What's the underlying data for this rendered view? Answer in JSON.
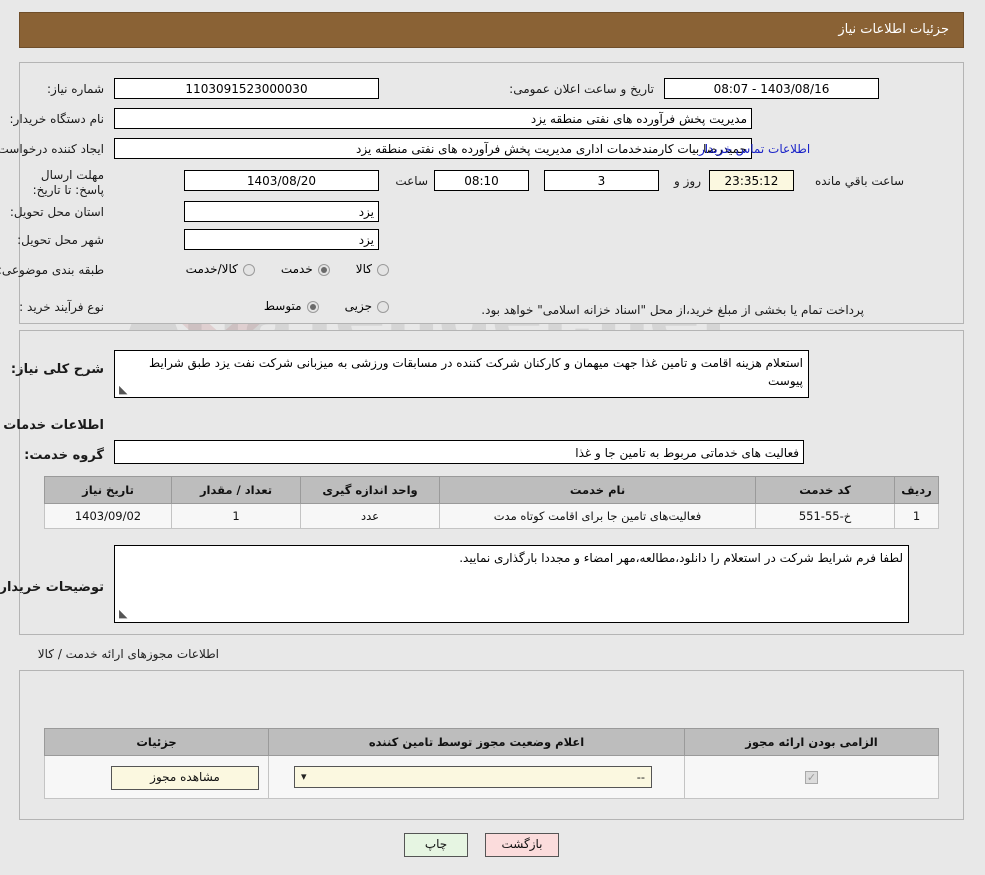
{
  "header": {
    "title": "جزئیات اطلاعات نیاز"
  },
  "watermark": {
    "text": "AriaTender.net"
  },
  "main": {
    "need_number_label": "شماره نیاز:",
    "need_number_value": "1103091523000030",
    "public_announce_label": "تاریخ و ساعت اعلان عمومی:",
    "public_announce_value": "1403/08/16 - 08:07",
    "buyer_org_label": "نام دستگاه خریدار:",
    "buyer_org_value": "مدیریت پخش فرآورده های نفتی منطقه یزد",
    "creator_label": "ایجاد کننده درخواست:",
    "creator_value": "حمیدرضا بیات کارمندخدمات اداری مدیریت پخش فرآورده های نفتی منطقه یزد",
    "contact_link": "اطلاعات تماس خریدار",
    "deadline_label": "مهلت ارسال پاسخ: تا تاریخ:",
    "deadline_date": "1403/08/20",
    "hour_label": "ساعت",
    "deadline_time": "08:10",
    "days_left": "3",
    "days_unit_label": "روز و",
    "time_left": "23:35:12",
    "time_left_suffix": "ساعت باقي مانده",
    "province_label": "استان محل تحویل:",
    "province_value": "یزد",
    "city_label": "شهر محل تحویل:",
    "city_value": "یزد",
    "category_label": "طبقه بندی موضوعی:",
    "category_options": [
      {
        "label": "کالا",
        "selected": false
      },
      {
        "label": "خدمت",
        "selected": true
      },
      {
        "label": "کالا/خدمت",
        "selected": false
      }
    ],
    "process_label": "نوع فرآیند خرید :",
    "process_options": [
      {
        "label": "جزیی",
        "selected": false
      },
      {
        "label": "متوسط",
        "selected": true
      }
    ],
    "process_note": "پرداخت تمام یا بخشی از مبلغ خرید،از محل \"اسناد خزانه اسلامی\" خواهد بود."
  },
  "description": {
    "general_label": "شرح کلی نیاز:",
    "general_value": "استعلام هزینه اقامت و تامین غذا جهت میهمان و کارکنان شرکت کننده در مسابقات ورزشی به میزبانی شرکت نفت یزد طبق شرایط پیوست",
    "services_section_title": "اطلاعات خدمات مورد نیاز",
    "service_group_label": "گروه خدمت:",
    "service_group_value": "فعالیت های خدماتی مربوط به تامین جا و غذا",
    "buyer_notes_label": "توضیحات خریدار:",
    "buyer_notes_value": "لطفا فرم شرایط شرکت در استعلام را دانلود،مطالعه،مهر امضاء و مجددا بارگذاری نمایید."
  },
  "services_table": {
    "columns": [
      "ردیف",
      "کد خدمت",
      "نام خدمت",
      "واحد اندازه گیری",
      "تعداد / مقدار",
      "تاریخ نیاز"
    ],
    "rows": [
      {
        "row": "1",
        "code": "خ-55-551",
        "name": "فعالیت‌های تامین جا برای اقامت کوتاه مدت",
        "unit": "عدد",
        "quantity": "1",
        "need_date": "1403/09/02"
      }
    ]
  },
  "licenses": {
    "section_title": "اطلاعات مجوزهای ارائه خدمت / کالا",
    "columns": [
      "الزامی بودن ارائه مجوز",
      "اعلام وضعیت مجوز توسط تامین کننده",
      "جزئیات"
    ],
    "rows": [
      {
        "required_checked": true,
        "status_value": "--",
        "details_button": "مشاهده مجوز"
      }
    ]
  },
  "footer": {
    "back_button": "بازگشت",
    "print_button": "چاپ"
  },
  "colors": {
    "header_brown": "#8a6235",
    "link_blue": "#1a23c8",
    "back_pink": "#fbdcdc",
    "print_green": "#e6f5e2",
    "field_cream": "#fbf8e0"
  }
}
